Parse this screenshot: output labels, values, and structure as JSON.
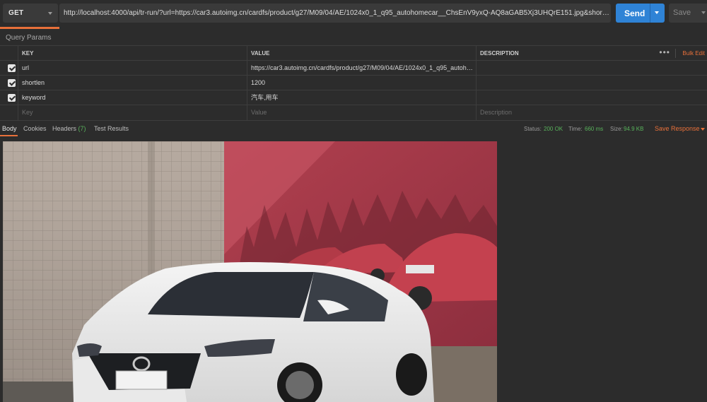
{
  "request": {
    "method": "GET",
    "url": "http://localhost:4000/api/tr-run/?url=https://car3.autoimg.cn/cardfs/product/g27/M09/04/AE/1024x0_1_q95_autohomecar__ChsEnV9yxQ-AQ8aGAB5Xj3UHQrE151.jpg&shortlen=1200&keyword=汽车,用…",
    "send_label": "Send",
    "save_label": "Save"
  },
  "params": {
    "section_title": "Query Params",
    "headers": {
      "key": "KEY",
      "value": "VALUE",
      "description": "DESCRIPTION"
    },
    "more_label": "•••",
    "bulk_edit": "Bulk Edit",
    "rows": [
      {
        "checked": true,
        "key": "url",
        "value": "https://car3.autoimg.cn/cardfs/product/g27/M09/04/AE/1024x0_1_q95_autohom…",
        "description": ""
      },
      {
        "checked": true,
        "key": "shortlen",
        "value": "1200",
        "description": ""
      },
      {
        "checked": true,
        "key": "keyword",
        "value": "汽车,用车",
        "description": ""
      }
    ],
    "placeholders": {
      "key": "Key",
      "value": "Value",
      "description": "Description"
    }
  },
  "response": {
    "tabs": [
      {
        "label": "Body",
        "active": true
      },
      {
        "label": "Cookies",
        "active": false
      },
      {
        "label": "Headers",
        "count": "(7)",
        "active": false
      },
      {
        "label": "Test Results",
        "active": false
      }
    ],
    "status_label": "Status:",
    "status_value": "200 OK",
    "time_label": "Time:",
    "time_value": "660 ms",
    "size_label": "Size:",
    "size_value": "94.9 KB",
    "save_response": "Save Response"
  },
  "colors": {
    "accent": "#e8703a",
    "send": "#2f83d6",
    "status_ok": "#58b25b",
    "background": "#2c2c2c"
  }
}
